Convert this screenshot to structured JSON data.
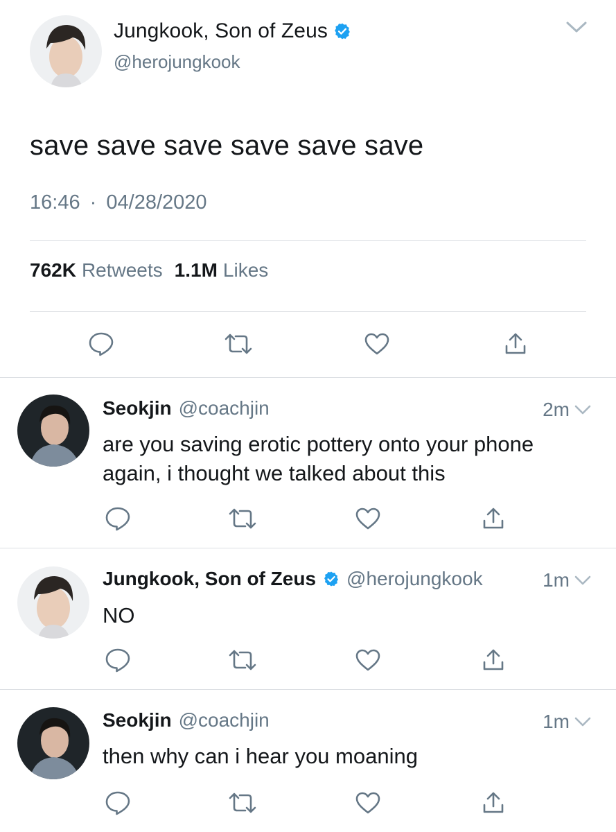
{
  "main_tweet": {
    "author_name": "Jungkook, Son of Zeus",
    "handle": "@herojungkook",
    "verified": true,
    "text": "save save save save save save",
    "time": "16:46",
    "date": "04/28/2020",
    "separator": "·",
    "retweets_count": "762K",
    "retweets_label": "Retweets",
    "likes_count": "1.1M",
    "likes_label": "Likes",
    "actions": [
      "reply-icon",
      "retweet-icon",
      "like-icon",
      "share-icon"
    ]
  },
  "replies": [
    {
      "author_name": "Seokjin",
      "handle": "@coachjin",
      "verified": false,
      "time": "2m",
      "text": "are you saving erotic pottery onto your phone again, i thought we talked about this"
    },
    {
      "author_name": "Jungkook, Son of Zeus",
      "handle": "@herojungkook",
      "verified": true,
      "time": "1m",
      "text": "NO"
    },
    {
      "author_name": "Seokjin",
      "handle": "@coachjin",
      "verified": false,
      "time": "1m",
      "text": "then why can i hear you moaning"
    }
  ],
  "colors": {
    "text_primary": "#14171a",
    "text_secondary": "#657786",
    "verified_blue": "#1da1f2",
    "icon_gray": "#657786",
    "divider": "#dcdfe3"
  }
}
